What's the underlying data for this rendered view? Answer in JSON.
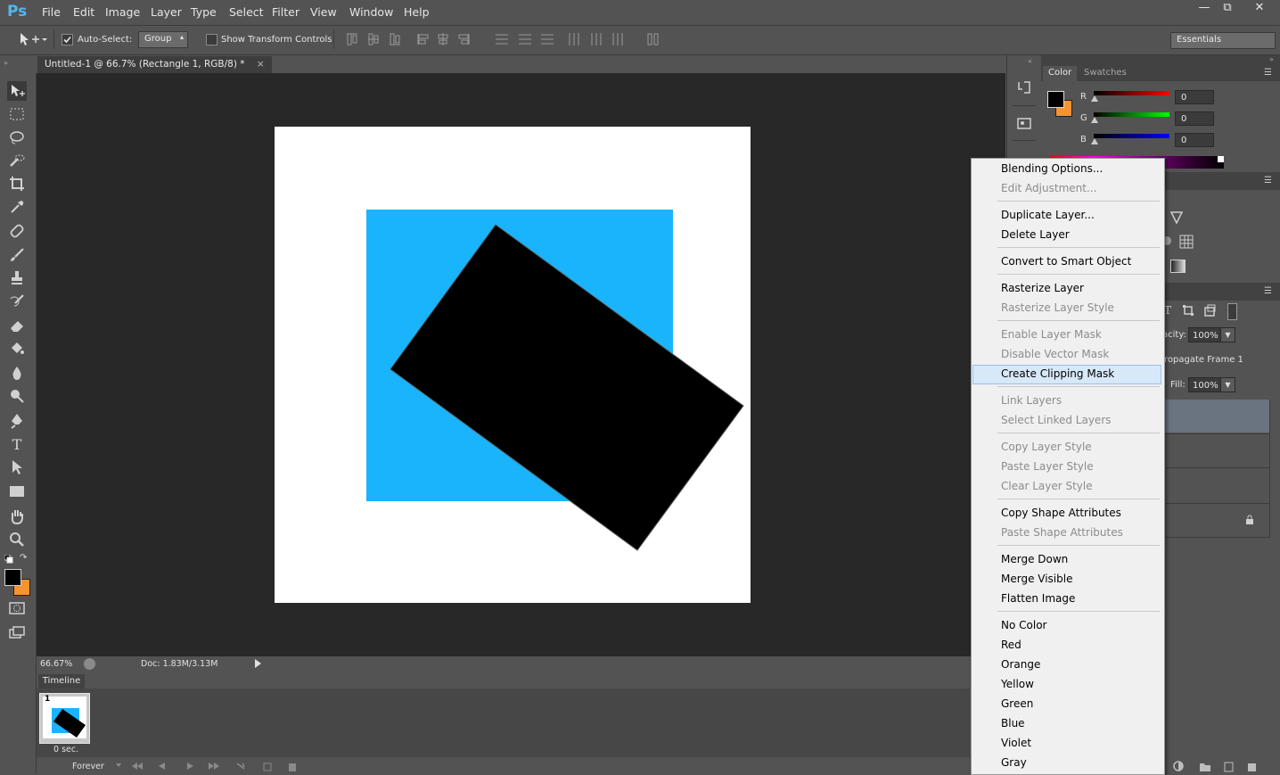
{
  "app": {
    "logo": "Ps"
  },
  "menubar": {
    "items": [
      "File",
      "Edit",
      "Image",
      "Layer",
      "Type",
      "Select",
      "Filter",
      "View",
      "Window",
      "Help"
    ],
    "window_controls": {
      "minimize": "—",
      "restore": "⧉",
      "close": "✕"
    }
  },
  "options_bar": {
    "auto_select_label": "Auto-Select:",
    "auto_select_checked": true,
    "auto_select_value": "Group",
    "show_transform_label": "Show Transform Controls",
    "workspace_value": "Essentials"
  },
  "document": {
    "tab_title": "Untitled-1 @ 66.7% (Rectangle 1, RGB/8) *",
    "tab_close": "×",
    "blue_rect_color": "#1ab4fc",
    "black_rect_color": "#000000"
  },
  "status": {
    "zoom": "66.67%",
    "doc_info": "Doc: 1.83M/3.13M"
  },
  "timeline": {
    "tab_label": "Timeline",
    "frame_number": "1",
    "frame_delay": "0 sec.",
    "loop_value": "Forever"
  },
  "color_panel": {
    "tabs": [
      "Color",
      "Swatches"
    ],
    "channels": [
      {
        "label": "R",
        "value": "0",
        "color": "#e00000"
      },
      {
        "label": "G",
        "value": "0",
        "color": "#00c000"
      },
      {
        "label": "B",
        "value": "0",
        "color": "#0000e0"
      }
    ],
    "foreground": "#000000",
    "background": "#f7932f"
  },
  "layers_panel": {
    "opacity_label": "acity:",
    "opacity_value": "100%",
    "propagate_label": "ropagate Frame 1",
    "fill_label": "Fill:",
    "fill_value": "100%"
  },
  "context_menu": {
    "groups": [
      [
        {
          "label": "Blending Options...",
          "enabled": true
        },
        {
          "label": "Edit Adjustment...",
          "enabled": false
        }
      ],
      [
        {
          "label": "Duplicate Layer...",
          "enabled": true
        },
        {
          "label": "Delete Layer",
          "enabled": true
        }
      ],
      [
        {
          "label": "Convert to Smart Object",
          "enabled": true
        }
      ],
      [
        {
          "label": "Rasterize Layer",
          "enabled": true
        },
        {
          "label": "Rasterize Layer Style",
          "enabled": false
        }
      ],
      [
        {
          "label": "Enable Layer Mask",
          "enabled": false
        },
        {
          "label": "Disable Vector Mask",
          "enabled": false
        },
        {
          "label": "Create Clipping Mask",
          "enabled": true,
          "highlighted": true
        }
      ],
      [
        {
          "label": "Link Layers",
          "enabled": false
        },
        {
          "label": "Select Linked Layers",
          "enabled": false
        }
      ],
      [
        {
          "label": "Copy Layer Style",
          "enabled": false
        },
        {
          "label": "Paste Layer Style",
          "enabled": false
        },
        {
          "label": "Clear Layer Style",
          "enabled": false
        }
      ],
      [
        {
          "label": "Copy Shape Attributes",
          "enabled": true
        },
        {
          "label": "Paste Shape Attributes",
          "enabled": false
        }
      ],
      [
        {
          "label": "Merge Down",
          "enabled": true
        },
        {
          "label": "Merge Visible",
          "enabled": true
        },
        {
          "label": "Flatten Image",
          "enabled": true
        }
      ],
      [
        {
          "label": "No Color",
          "enabled": true
        },
        {
          "label": "Red",
          "enabled": true
        },
        {
          "label": "Orange",
          "enabled": true
        },
        {
          "label": "Yellow",
          "enabled": true
        },
        {
          "label": "Green",
          "enabled": true
        },
        {
          "label": "Blue",
          "enabled": true
        },
        {
          "label": "Violet",
          "enabled": true
        },
        {
          "label": "Gray",
          "enabled": true
        }
      ]
    ]
  }
}
